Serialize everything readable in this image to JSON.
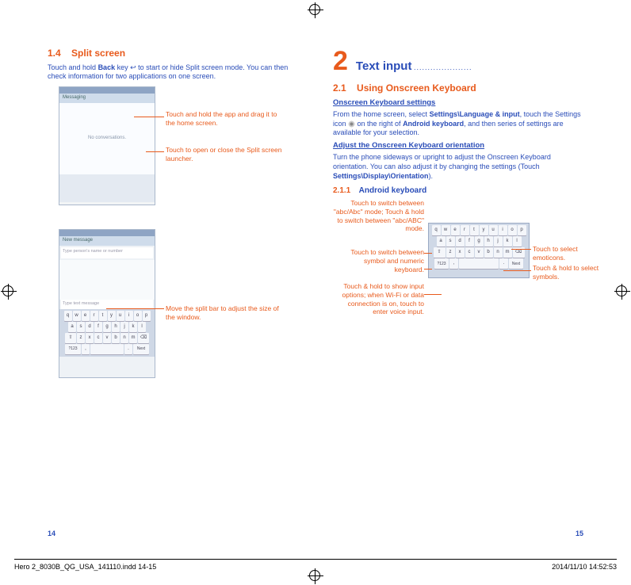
{
  "left": {
    "heading_num": "1.4",
    "heading_title": "Split screen",
    "intro_a": "Touch and hold ",
    "intro_bold1": "Back",
    "intro_b": " key ",
    "intro_c": " to start or hide Split screen mode. You can then check information for two applications on one screen.",
    "shot1_header": "Messaging",
    "shot1_empty": "No conversations.",
    "callout1": "Touch and hold the app and drag it to the home screen.",
    "callout2": "Touch to open or close the Split screen launcher.",
    "shot2_header": "New message",
    "shot2_input": "Type person's name or number",
    "shot2_msg": "Type text message",
    "callout3": "Move the split bar to adjust the size of the window."
  },
  "kb_rows": {
    "r1": [
      "q",
      "w",
      "e",
      "r",
      "t",
      "y",
      "u",
      "i",
      "o",
      "p"
    ],
    "r2": [
      "a",
      "s",
      "d",
      "f",
      "g",
      "h",
      "j",
      "k",
      "l"
    ],
    "r3_shift": "⇧",
    "r3": [
      "z",
      "x",
      "c",
      "v",
      "b",
      "n",
      "m"
    ],
    "r3_del": "⌫",
    "r4_sym": "?123",
    "r4_comma": ",",
    "r4_space": "",
    "r4_dot": ".",
    "r4_next": "Next"
  },
  "right": {
    "big": "2",
    "chapter": "Text input",
    "dots": ".....................",
    "sec21_num": "2.1",
    "sec21_title": "Using Onscreen Keyboard",
    "sub1": "Onscreen Keyboard settings",
    "p1_a": "From the home screen, select ",
    "p1_b1": "Settings\\Language & input",
    "p1_b": ", touch the Settings icon ",
    "p1_c": " on the right of ",
    "p1_b2": "Android keyboard",
    "p1_d": ", and then series of settings are available for your selection.",
    "sub2": "Adjust the Onscreen Keyboard orientation",
    "p2_a": "Turn the phone sideways or upright to adjust the Onscreen Keyboard orientation. You can also adjust it by changing the settings (Touch ",
    "p2_b": "Settings\\Display\\Orientation",
    "p2_c": ").",
    "sec211_num": "2.1.1",
    "sec211_title": "Android keyboard",
    "annL1": "Touch to switch between \"abc/Abc\" mode; Touch & hold to switch between \"abc/ABC\" mode.",
    "annL2": "Touch to switch between symbol and numeric keyboard.",
    "annL3": "Touch & hold to show input options; when Wi-Fi or data connection is on, touch to enter voice input.",
    "annR1": "Touch to select emoticons.",
    "annR2": "Touch & hold to select symbols."
  },
  "footer": {
    "page_left": "14",
    "page_right": "15",
    "file": "Hero 2_8030B_QG_USA_141110.indd   14-15",
    "timestamp": "2014/11/10   14:52:53"
  }
}
